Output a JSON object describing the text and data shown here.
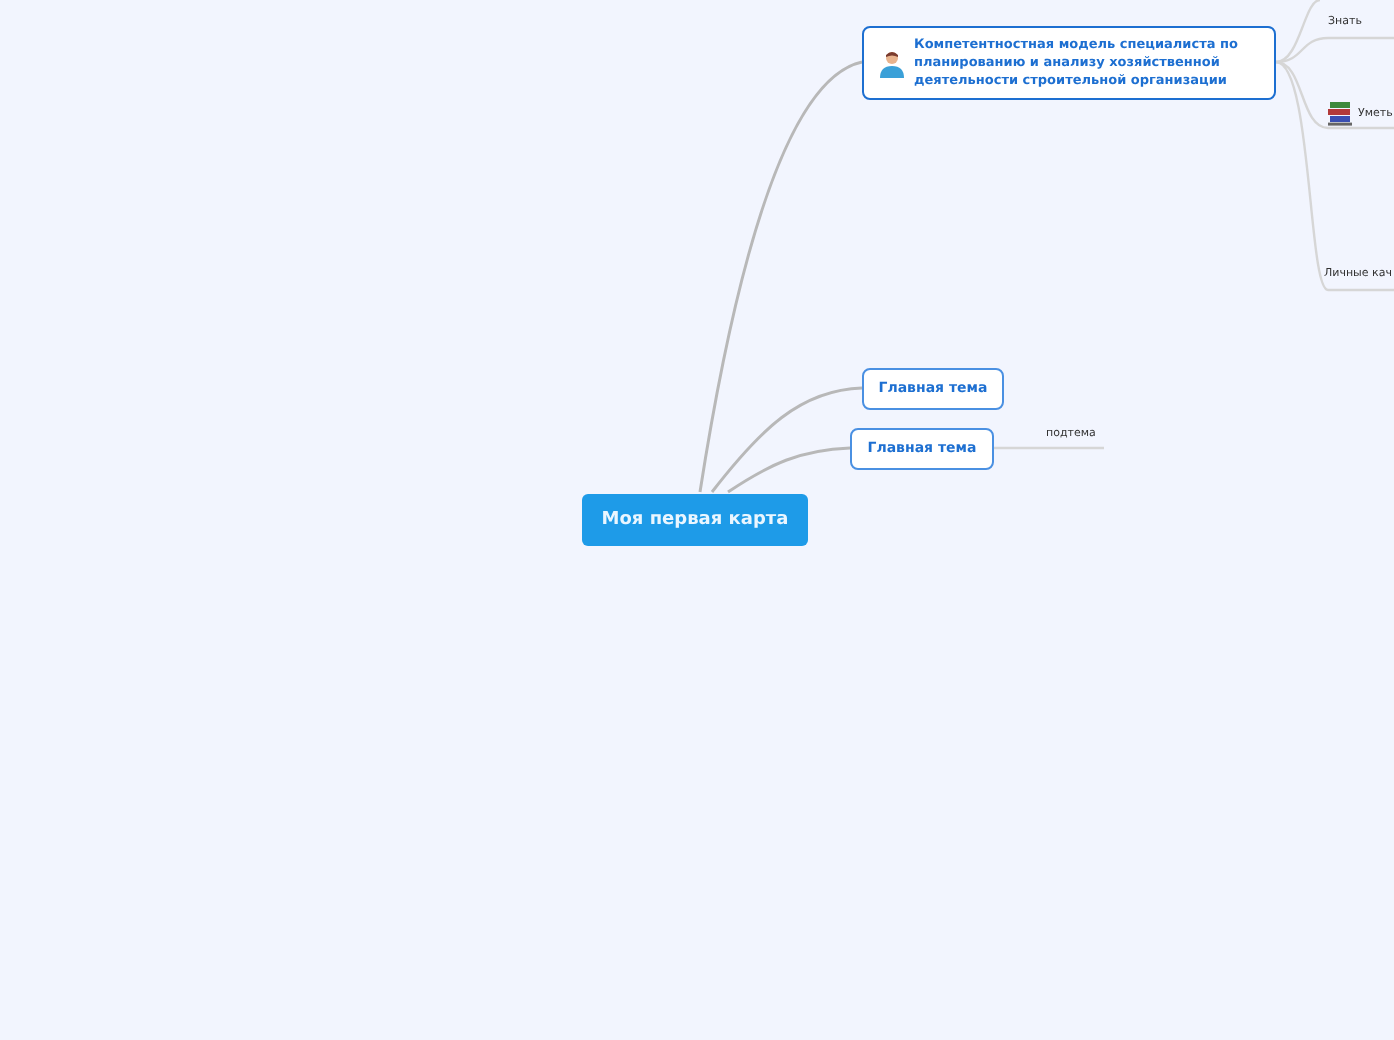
{
  "root": {
    "label": "Моя первая карта"
  },
  "topics": [
    {
      "label": "Компетентностная модель специалиста по планированию и анализу хозяйственной деятельности строительной организации",
      "subtopics": [
        {
          "label": "Знать"
        },
        {
          "label": "Уметь"
        },
        {
          "label": "Личные кач"
        }
      ]
    },
    {
      "label": "Главная тема"
    },
    {
      "label": "Главная тема",
      "subtopics": [
        {
          "label": "подтема"
        }
      ]
    }
  ]
}
